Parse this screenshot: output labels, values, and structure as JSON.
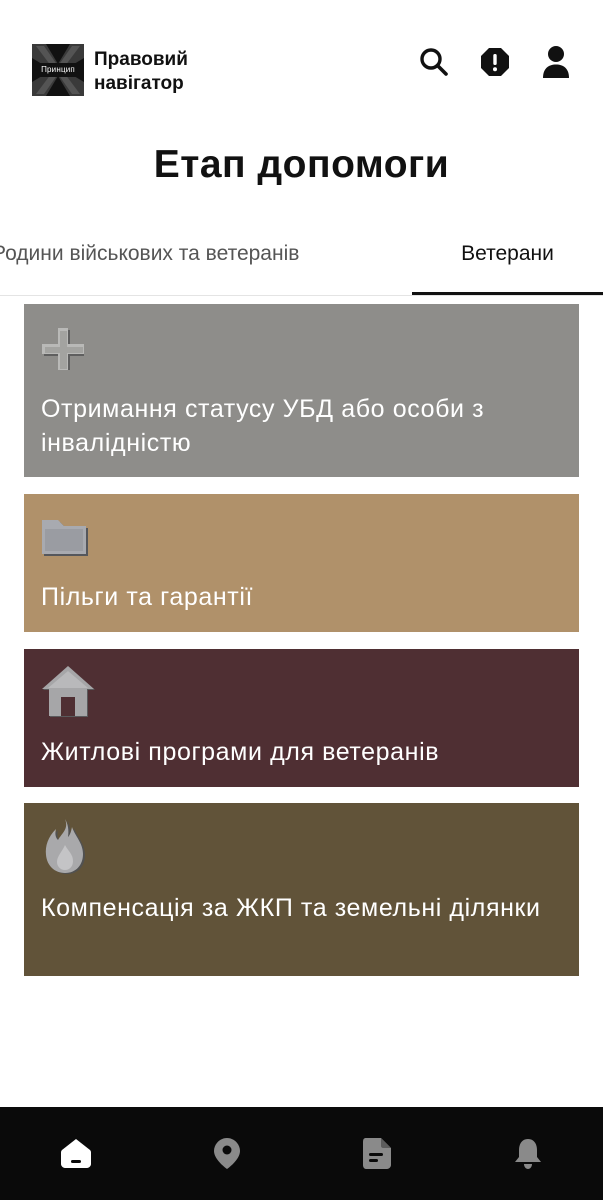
{
  "header": {
    "logo_text": "Принцип",
    "brand_line1": "Правовий",
    "brand_line2": "навігатор",
    "icons": [
      "search-icon",
      "alert-icon",
      "profile-icon"
    ]
  },
  "page_title": "Етап допомоги",
  "tabs": [
    {
      "label": "Родини військових та ветеранів",
      "active": false
    },
    {
      "label": "Ветерани",
      "active": true
    }
  ],
  "cards": [
    {
      "label": "Отримання статусу УБД або особи з інвалідністю",
      "icon": "plus-icon",
      "color": "#8e8d8a"
    },
    {
      "label": "Пільги та гарантії",
      "icon": "folder-icon",
      "color": "#b0916a"
    },
    {
      "label": "Житлові програми для ветеранів",
      "icon": "house-icon",
      "color": "#4f2f33"
    },
    {
      "label": "Компенсація за ЖКП та земельні ділянки",
      "icon": "flame-icon",
      "color": "#615339"
    }
  ],
  "bottom_nav": {
    "items": [
      "home-icon",
      "location-icon",
      "document-icon",
      "bell-icon"
    ],
    "active": "home-icon"
  }
}
